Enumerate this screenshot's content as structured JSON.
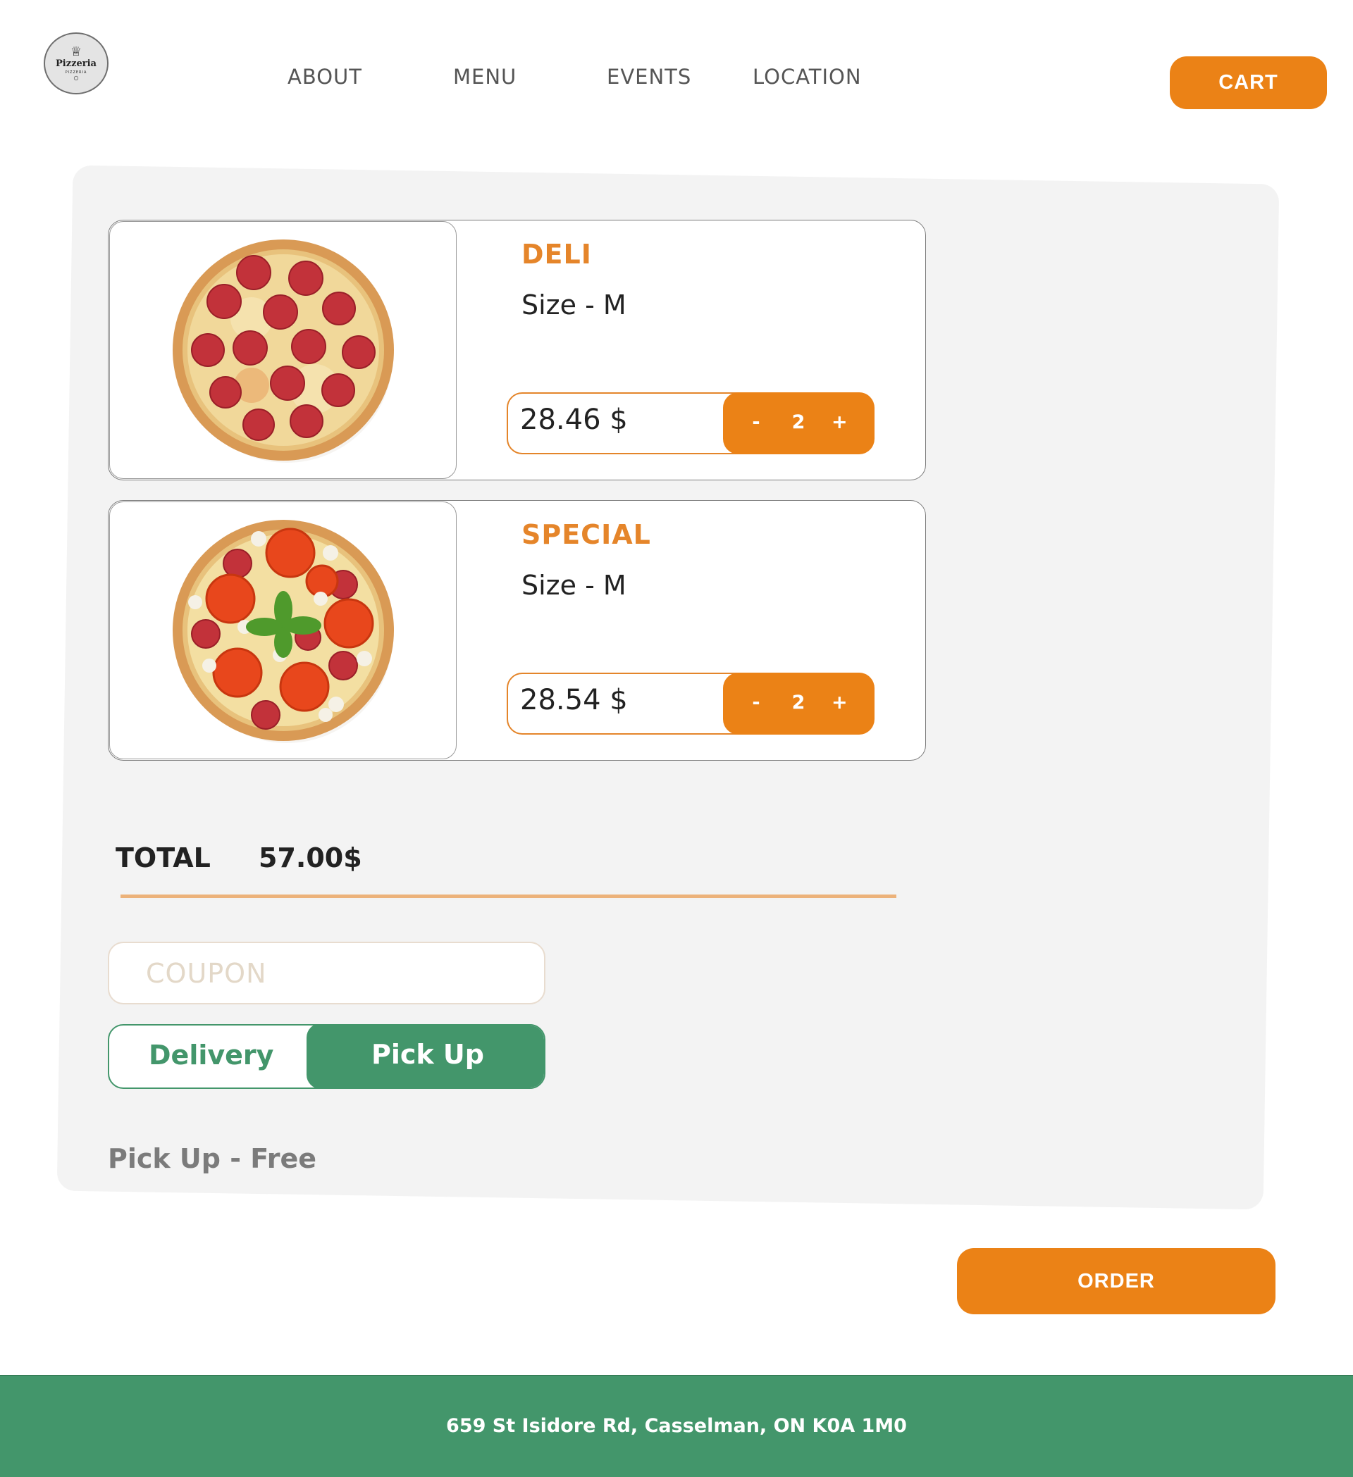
{
  "header": {
    "logo": {
      "text": "Pizzeria",
      "subtext": "PIZZERIA"
    },
    "nav": [
      "ABOUT",
      "MENU",
      "EVENTS",
      "LOCATION"
    ],
    "cart_label": "CART"
  },
  "cart": {
    "items": [
      {
        "name": "DELI",
        "size": "Size - M",
        "price": "28.46 $",
        "quantity": "2",
        "minus": "-",
        "plus": "+",
        "image": "pepperoni-pizza"
      },
      {
        "name": "SPECIAL",
        "size": "Size - M",
        "price": "28.54 $",
        "quantity": "2",
        "minus": "-",
        "plus": "+",
        "image": "special-pizza"
      }
    ],
    "total_label": "TOTAL",
    "total_value": "57.00$",
    "coupon_placeholder": "COUPON",
    "delivery_options": {
      "delivery": "Delivery",
      "pickup": "Pick Up",
      "selected": "Pick Up"
    },
    "fee_text": "Pick Up - Free",
    "order_label": "ORDER"
  },
  "footer": {
    "address": "659 St Isidore Rd, Casselman, ON K0A 1M0"
  },
  "colors": {
    "accent": "#eb8216",
    "green": "#43966b",
    "panel": "#f3f3f3"
  }
}
